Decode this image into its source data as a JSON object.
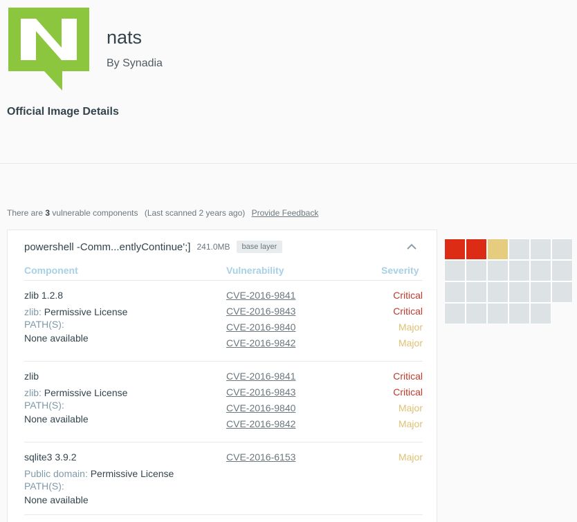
{
  "repo": {
    "name": "nats",
    "by": "By Synadia",
    "logo_icon": "nats-logo-icon",
    "logo_color": "#8cc63f"
  },
  "section_title": "Official Image Details",
  "summary": {
    "prefix": "There are",
    "count": "3",
    "suffix": "vulnerable components",
    "scanned": "(Last scanned 2 years ago)",
    "feedback": "Provide Feedback"
  },
  "layer": {
    "command": "powershell -Comm...entlyContinue';]",
    "size": "241.0MB",
    "badge": "base layer",
    "collapse_icon": "chevron-up-icon"
  },
  "columns": {
    "component": "Component",
    "vulnerability": "Vulnerability",
    "severity": "Severity"
  },
  "components": [
    {
      "name": "zlib 1.2.8",
      "license_name": "zlib:",
      "license_value": "Permissive License",
      "path_label": "PATH(S):",
      "path_value": "None available",
      "vulns": [
        {
          "cve": "CVE-2016-9841",
          "severity": "Critical"
        },
        {
          "cve": "CVE-2016-9843",
          "severity": "Critical"
        },
        {
          "cve": "CVE-2016-9840",
          "severity": "Major"
        },
        {
          "cve": "CVE-2016-9842",
          "severity": "Major"
        }
      ]
    },
    {
      "name": "zlib",
      "license_name": "zlib:",
      "license_value": "Permissive License",
      "path_label": "PATH(S):",
      "path_value": "None available",
      "vulns": [
        {
          "cve": "CVE-2016-9841",
          "severity": "Critical"
        },
        {
          "cve": "CVE-2016-9843",
          "severity": "Critical"
        },
        {
          "cve": "CVE-2016-9840",
          "severity": "Major"
        },
        {
          "cve": "CVE-2016-9842",
          "severity": "Major"
        }
      ]
    },
    {
      "name": "sqlite3 3.9.2",
      "license_name": "Public domain:",
      "license_value": "Permissive License",
      "path_label": "PATH(S):",
      "path_value": "None available",
      "vulns": [
        {
          "cve": "CVE-2016-6153",
          "severity": "Major"
        }
      ]
    }
  ],
  "heatmap": {
    "colors": {
      "critical": "#dd2c16",
      "major": "#e5cc7e",
      "none": "#dde2e5"
    },
    "rows": [
      [
        "critical",
        "critical",
        "major",
        "none",
        "none",
        "none"
      ],
      [
        "none",
        "none",
        "none",
        "none",
        "none",
        "none"
      ],
      [
        "none",
        "none",
        "none",
        "none",
        "none",
        "none"
      ],
      [
        "none",
        "none",
        "none",
        "none",
        "none"
      ]
    ]
  }
}
